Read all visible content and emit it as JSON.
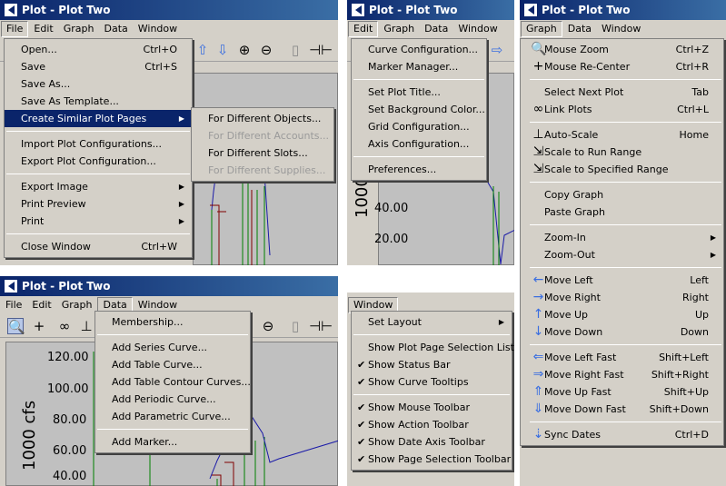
{
  "window_title": "Plot - Plot Two",
  "menus": {
    "file": "File",
    "edit": "Edit",
    "graph": "Graph",
    "data": "Data",
    "window": "Window"
  },
  "axis": {
    "unit_label": "1000 cfs",
    "ticks_a": [
      "40.00",
      "20.00"
    ],
    "ticks_b": [
      "120.00",
      "100.00",
      "80.00",
      "60.00",
      "40.00"
    ]
  },
  "file_menu": [
    {
      "label": "Open...",
      "acc": "Ctrl+O"
    },
    {
      "label": "Save",
      "acc": "Ctrl+S"
    },
    {
      "label": "Save As..."
    },
    {
      "label": "Save As Template..."
    },
    {
      "label": "Create Similar Plot Pages",
      "sub": "▶",
      "selected": true
    },
    {
      "sep": true
    },
    {
      "label": "Import Plot Configurations..."
    },
    {
      "label": "Export Plot Configuration..."
    },
    {
      "sep": true
    },
    {
      "label": "Export Image",
      "sub": "▶"
    },
    {
      "label": "Print Preview",
      "sub": "▶"
    },
    {
      "label": "Print",
      "sub": "▶"
    },
    {
      "sep": true
    },
    {
      "label": "Close Window",
      "acc": "Ctrl+W"
    }
  ],
  "similar_submenu": [
    {
      "label": "For Different Objects..."
    },
    {
      "label": "For Different Accounts...",
      "disabled": true
    },
    {
      "label": "For Different Slots..."
    },
    {
      "label": "For Different Supplies...",
      "disabled": true
    }
  ],
  "edit_menu": [
    {
      "label": "Curve Configuration..."
    },
    {
      "label": "Marker Manager..."
    },
    {
      "sep": true
    },
    {
      "label": "Set Plot Title..."
    },
    {
      "label": "Set Background Color..."
    },
    {
      "label": "Grid Configuration..."
    },
    {
      "label": "Axis Configuration..."
    },
    {
      "sep": true
    },
    {
      "label": "Preferences..."
    }
  ],
  "graph_menu": [
    {
      "label": "Mouse Zoom",
      "acc": "Ctrl+Z",
      "icon": "🔍"
    },
    {
      "label": "Mouse Re-Center",
      "acc": "Ctrl+R",
      "icon": "+"
    },
    {
      "sep": true
    },
    {
      "label": "Select Next Plot",
      "acc": "Tab"
    },
    {
      "label": "Link Plots",
      "acc": "Ctrl+L",
      "icon": "∞"
    },
    {
      "sep": true
    },
    {
      "label": "Auto-Scale",
      "acc": "Home",
      "icon": "⊥"
    },
    {
      "label": "Scale to Run Range",
      "icon": "⇲"
    },
    {
      "label": "Scale to Specified Range",
      "icon": "⇲"
    },
    {
      "sep": true
    },
    {
      "label": "Copy Graph"
    },
    {
      "label": "Paste Graph"
    },
    {
      "sep": true
    },
    {
      "label": "Zoom-In",
      "sub": "▶"
    },
    {
      "label": "Zoom-Out",
      "sub": "▶"
    },
    {
      "sep": true
    },
    {
      "label": "Move Left",
      "acc": "Left",
      "icon": "←"
    },
    {
      "label": "Move Right",
      "acc": "Right",
      "icon": "→"
    },
    {
      "label": "Move Up",
      "acc": "Up",
      "icon": "↑"
    },
    {
      "label": "Move Down",
      "acc": "Down",
      "icon": "↓"
    },
    {
      "sep": true
    },
    {
      "label": "Move Left Fast",
      "acc": "Shift+Left",
      "icon": "⇐"
    },
    {
      "label": "Move Right Fast",
      "acc": "Shift+Right",
      "icon": "⇒"
    },
    {
      "label": "Move Up Fast",
      "acc": "Shift+Up",
      "icon": "⇑"
    },
    {
      "label": "Move Down Fast",
      "acc": "Shift+Down",
      "icon": "⇓"
    },
    {
      "sep": true
    },
    {
      "label": "Sync Dates",
      "acc": "Ctrl+D",
      "icon": "⇣"
    }
  ],
  "data_menu": [
    {
      "label": "Membership..."
    },
    {
      "sep": true
    },
    {
      "label": "Add Series Curve..."
    },
    {
      "label": "Add Table Curve..."
    },
    {
      "label": "Add Table Contour Curves..."
    },
    {
      "label": "Add Periodic Curve..."
    },
    {
      "label": "Add Parametric Curve..."
    },
    {
      "sep": true
    },
    {
      "label": "Add Marker..."
    }
  ],
  "window_menu": [
    {
      "label": "Set Layout",
      "sub": "▶"
    },
    {
      "sep": true
    },
    {
      "label": "Show Plot Page Selection List"
    },
    {
      "label": "Show Status Bar",
      "checked": true
    },
    {
      "label": "Show Curve Tooltips",
      "checked": true
    },
    {
      "sep": true
    },
    {
      "label": "Show Mouse Toolbar",
      "checked": true
    },
    {
      "label": "Show Action Toolbar",
      "checked": true
    },
    {
      "label": "Show Date Axis Toolbar",
      "checked": true
    },
    {
      "label": "Show Page Selection Toolbar",
      "checked": true
    }
  ]
}
